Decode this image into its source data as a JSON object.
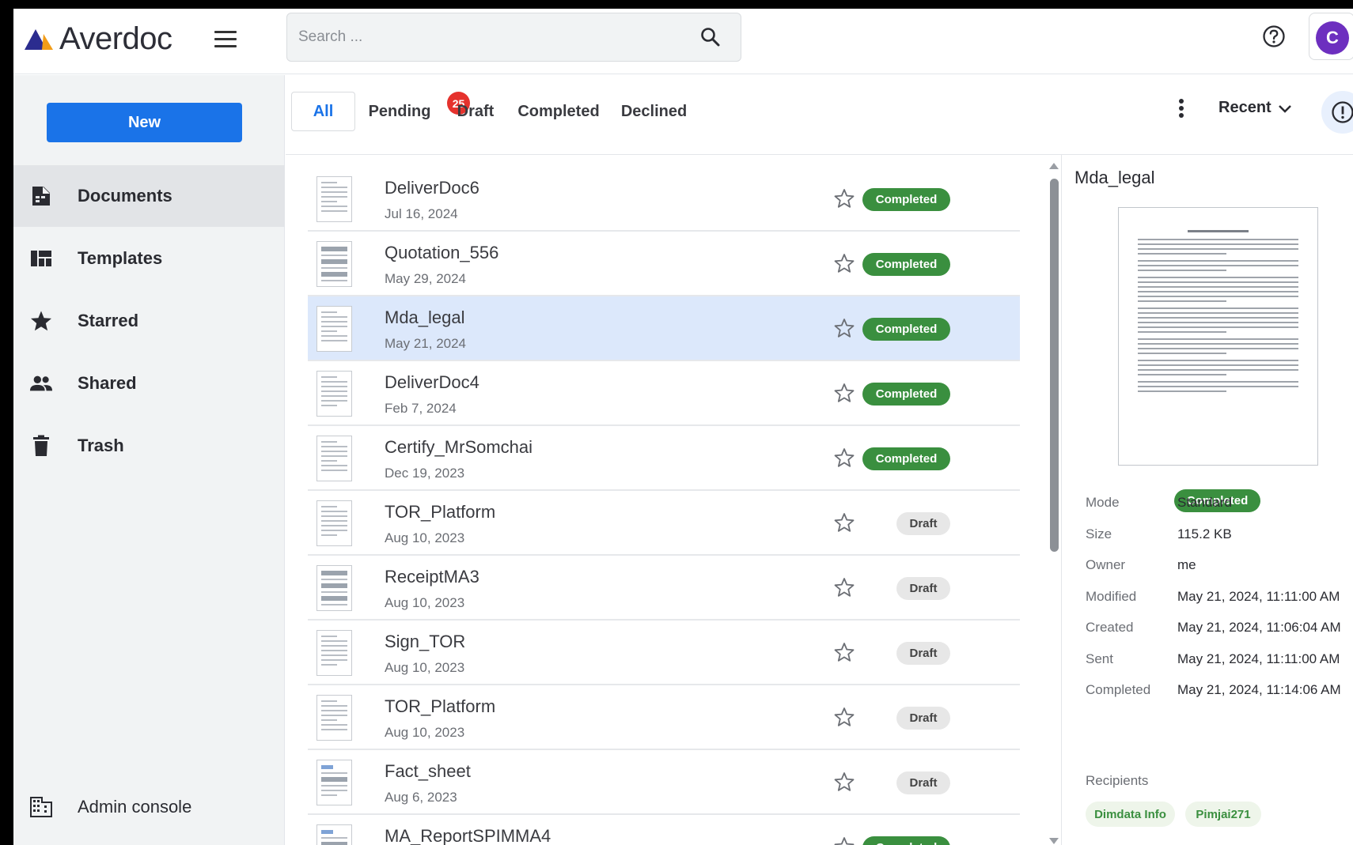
{
  "app": {
    "name": "Averdoc",
    "brand_colors": [
      "#2b2c8f",
      "#f29d18"
    ]
  },
  "search": {
    "placeholder": "Search ..."
  },
  "header": {
    "avatar_initial": "C"
  },
  "sidebar": {
    "new_label": "New",
    "items": [
      {
        "label": "Documents",
        "icon": "document-icon",
        "active": true
      },
      {
        "label": "Templates",
        "icon": "templates-icon"
      },
      {
        "label": "Starred",
        "icon": "star-icon"
      },
      {
        "label": "Shared",
        "icon": "people-icon"
      },
      {
        "label": "Trash",
        "icon": "trash-icon"
      }
    ],
    "admin_label": "Admin console"
  },
  "tabs": {
    "items": [
      "All",
      "Pending",
      "Draft",
      "Completed",
      "Declined"
    ],
    "active": "All",
    "pending_count": "25",
    "sort_label": "Recent"
  },
  "documents": [
    {
      "name": "DeliverDoc6",
      "date": "Jul 16, 2024",
      "status": "Completed"
    },
    {
      "name": "Quotation_556",
      "date": "May 29, 2024",
      "status": "Completed"
    },
    {
      "name": "Mda_legal",
      "date": "May 21, 2024",
      "status": "Completed",
      "selected": true
    },
    {
      "name": "DeliverDoc4",
      "date": "Feb 7, 2024",
      "status": "Completed"
    },
    {
      "name": "Certify_MrSomchai",
      "date": "Dec 19, 2023",
      "status": "Completed"
    },
    {
      "name": "TOR_Platform",
      "date": "Aug 10, 2023",
      "status": "Draft"
    },
    {
      "name": "ReceiptMA3",
      "date": "Aug 10, 2023",
      "status": "Draft"
    },
    {
      "name": "Sign_TOR",
      "date": "Aug 10, 2023",
      "status": "Draft"
    },
    {
      "name": "TOR_Platform",
      "date": "Aug 10, 2023",
      "status": "Draft"
    },
    {
      "name": "Fact_sheet",
      "date": "Aug 6, 2023",
      "status": "Draft"
    },
    {
      "name": "MA_ReportSPIMMA4",
      "date": "",
      "status": "Completed"
    }
  ],
  "details": {
    "title": "Mda_legal",
    "status": "Completed",
    "meta": [
      {
        "label": "Mode",
        "value": "Standard"
      },
      {
        "label": "Size",
        "value": "115.2 KB"
      },
      {
        "label": "Owner",
        "value": "me"
      },
      {
        "label": "Modified",
        "value": "May 21, 2024, 11:11:00 AM"
      },
      {
        "label": "Created",
        "value": "May 21, 2024, 11:06:04 AM"
      },
      {
        "label": "Sent",
        "value": "May 21, 2024, 11:11:00 AM"
      },
      {
        "label": "Completed",
        "value": "May 21, 2024, 11:14:06 AM"
      }
    ],
    "recipients_label": "Recipients",
    "recipients": [
      "Dimdata Info",
      "Pimjai271"
    ]
  },
  "colors": {
    "accent": "#1a73e8",
    "completed": "#3a8f3f",
    "selected_row": "#dce8fb",
    "badge": "#e5322d"
  }
}
